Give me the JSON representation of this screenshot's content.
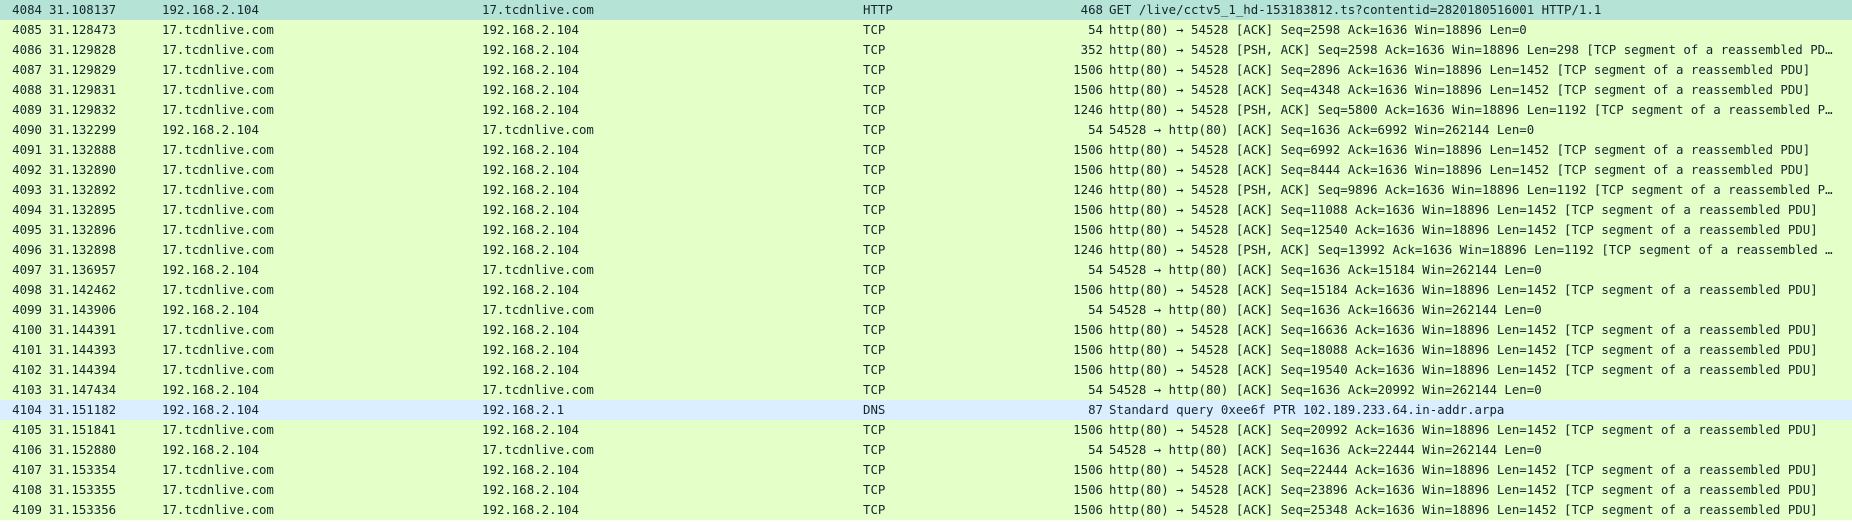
{
  "packets": [
    {
      "no": "4084",
      "time": "31.108137",
      "src": "192.168.2.104",
      "dst": "17.tcdnlive.com",
      "proto": "HTTP",
      "len": "468",
      "info": "GET /live/cctv5_1_hd-153183812.ts?contentid=2820180516001 HTTP/1.1",
      "kind": "http",
      "selected": true
    },
    {
      "no": "4085",
      "time": "31.128473",
      "src": "17.tcdnlive.com",
      "dst": "192.168.2.104",
      "proto": "TCP",
      "len": "54",
      "info": "http(80) → 54528 [ACK] Seq=2598 Ack=1636 Win=18896 Len=0",
      "kind": "tcp"
    },
    {
      "no": "4086",
      "time": "31.129828",
      "src": "17.tcdnlive.com",
      "dst": "192.168.2.104",
      "proto": "TCP",
      "len": "352",
      "info": "http(80) → 54528 [PSH, ACK] Seq=2598 Ack=1636 Win=18896 Len=298 [TCP segment of a reassembled PDU]",
      "kind": "tcp"
    },
    {
      "no": "4087",
      "time": "31.129829",
      "src": "17.tcdnlive.com",
      "dst": "192.168.2.104",
      "proto": "TCP",
      "len": "1506",
      "info": "http(80) → 54528 [ACK] Seq=2896 Ack=1636 Win=18896 Len=1452 [TCP segment of a reassembled PDU]",
      "kind": "tcp"
    },
    {
      "no": "4088",
      "time": "31.129831",
      "src": "17.tcdnlive.com",
      "dst": "192.168.2.104",
      "proto": "TCP",
      "len": "1506",
      "info": "http(80) → 54528 [ACK] Seq=4348 Ack=1636 Win=18896 Len=1452 [TCP segment of a reassembled PDU]",
      "kind": "tcp"
    },
    {
      "no": "4089",
      "time": "31.129832",
      "src": "17.tcdnlive.com",
      "dst": "192.168.2.104",
      "proto": "TCP",
      "len": "1246",
      "info": "http(80) → 54528 [PSH, ACK] Seq=5800 Ack=1636 Win=18896 Len=1192 [TCP segment of a reassembled PD…",
      "kind": "tcp"
    },
    {
      "no": "4090",
      "time": "31.132299",
      "src": "192.168.2.104",
      "dst": "17.tcdnlive.com",
      "proto": "TCP",
      "len": "54",
      "info": "54528 → http(80) [ACK] Seq=1636 Ack=6992 Win=262144 Len=0",
      "kind": "tcp"
    },
    {
      "no": "4091",
      "time": "31.132888",
      "src": "17.tcdnlive.com",
      "dst": "192.168.2.104",
      "proto": "TCP",
      "len": "1506",
      "info": "http(80) → 54528 [ACK] Seq=6992 Ack=1636 Win=18896 Len=1452 [TCP segment of a reassembled PDU]",
      "kind": "tcp"
    },
    {
      "no": "4092",
      "time": "31.132890",
      "src": "17.tcdnlive.com",
      "dst": "192.168.2.104",
      "proto": "TCP",
      "len": "1506",
      "info": "http(80) → 54528 [ACK] Seq=8444 Ack=1636 Win=18896 Len=1452 [TCP segment of a reassembled PDU]",
      "kind": "tcp"
    },
    {
      "no": "4093",
      "time": "31.132892",
      "src": "17.tcdnlive.com",
      "dst": "192.168.2.104",
      "proto": "TCP",
      "len": "1246",
      "info": "http(80) → 54528 [PSH, ACK] Seq=9896 Ack=1636 Win=18896 Len=1192 [TCP segment of a reassembled PD…",
      "kind": "tcp"
    },
    {
      "no": "4094",
      "time": "31.132895",
      "src": "17.tcdnlive.com",
      "dst": "192.168.2.104",
      "proto": "TCP",
      "len": "1506",
      "info": "http(80) → 54528 [ACK] Seq=11088 Ack=1636 Win=18896 Len=1452 [TCP segment of a reassembled PDU]",
      "kind": "tcp"
    },
    {
      "no": "4095",
      "time": "31.132896",
      "src": "17.tcdnlive.com",
      "dst": "192.168.2.104",
      "proto": "TCP",
      "len": "1506",
      "info": "http(80) → 54528 [ACK] Seq=12540 Ack=1636 Win=18896 Len=1452 [TCP segment of a reassembled PDU]",
      "kind": "tcp"
    },
    {
      "no": "4096",
      "time": "31.132898",
      "src": "17.tcdnlive.com",
      "dst": "192.168.2.104",
      "proto": "TCP",
      "len": "1246",
      "info": "http(80) → 54528 [PSH, ACK] Seq=13992 Ack=1636 Win=18896 Len=1192 [TCP segment of a reassembled P…",
      "kind": "tcp"
    },
    {
      "no": "4097",
      "time": "31.136957",
      "src": "192.168.2.104",
      "dst": "17.tcdnlive.com",
      "proto": "TCP",
      "len": "54",
      "info": "54528 → http(80) [ACK] Seq=1636 Ack=15184 Win=262144 Len=0",
      "kind": "tcp"
    },
    {
      "no": "4098",
      "time": "31.142462",
      "src": "17.tcdnlive.com",
      "dst": "192.168.2.104",
      "proto": "TCP",
      "len": "1506",
      "info": "http(80) → 54528 [ACK] Seq=15184 Ack=1636 Win=18896 Len=1452 [TCP segment of a reassembled PDU]",
      "kind": "tcp"
    },
    {
      "no": "4099",
      "time": "31.143906",
      "src": "192.168.2.104",
      "dst": "17.tcdnlive.com",
      "proto": "TCP",
      "len": "54",
      "info": "54528 → http(80) [ACK] Seq=1636 Ack=16636 Win=262144 Len=0",
      "kind": "tcp"
    },
    {
      "no": "4100",
      "time": "31.144391",
      "src": "17.tcdnlive.com",
      "dst": "192.168.2.104",
      "proto": "TCP",
      "len": "1506",
      "info": "http(80) → 54528 [ACK] Seq=16636 Ack=1636 Win=18896 Len=1452 [TCP segment of a reassembled PDU]",
      "kind": "tcp"
    },
    {
      "no": "4101",
      "time": "31.144393",
      "src": "17.tcdnlive.com",
      "dst": "192.168.2.104",
      "proto": "TCP",
      "len": "1506",
      "info": "http(80) → 54528 [ACK] Seq=18088 Ack=1636 Win=18896 Len=1452 [TCP segment of a reassembled PDU]",
      "kind": "tcp"
    },
    {
      "no": "4102",
      "time": "31.144394",
      "src": "17.tcdnlive.com",
      "dst": "192.168.2.104",
      "proto": "TCP",
      "len": "1506",
      "info": "http(80) → 54528 [ACK] Seq=19540 Ack=1636 Win=18896 Len=1452 [TCP segment of a reassembled PDU]",
      "kind": "tcp"
    },
    {
      "no": "4103",
      "time": "31.147434",
      "src": "192.168.2.104",
      "dst": "17.tcdnlive.com",
      "proto": "TCP",
      "len": "54",
      "info": "54528 → http(80) [ACK] Seq=1636 Ack=20992 Win=262144 Len=0",
      "kind": "tcp"
    },
    {
      "no": "4104",
      "time": "31.151182",
      "src": "192.168.2.104",
      "dst": "192.168.2.1",
      "proto": "DNS",
      "len": "87",
      "info": "Standard query 0xee6f PTR 102.189.233.64.in-addr.arpa",
      "kind": "dns"
    },
    {
      "no": "4105",
      "time": "31.151841",
      "src": "17.tcdnlive.com",
      "dst": "192.168.2.104",
      "proto": "TCP",
      "len": "1506",
      "info": "http(80) → 54528 [ACK] Seq=20992 Ack=1636 Win=18896 Len=1452 [TCP segment of a reassembled PDU]",
      "kind": "tcp"
    },
    {
      "no": "4106",
      "time": "31.152880",
      "src": "192.168.2.104",
      "dst": "17.tcdnlive.com",
      "proto": "TCP",
      "len": "54",
      "info": "54528 → http(80) [ACK] Seq=1636 Ack=22444 Win=262144 Len=0",
      "kind": "tcp"
    },
    {
      "no": "4107",
      "time": "31.153354",
      "src": "17.tcdnlive.com",
      "dst": "192.168.2.104",
      "proto": "TCP",
      "len": "1506",
      "info": "http(80) → 54528 [ACK] Seq=22444 Ack=1636 Win=18896 Len=1452 [TCP segment of a reassembled PDU]",
      "kind": "tcp"
    },
    {
      "no": "4108",
      "time": "31.153355",
      "src": "17.tcdnlive.com",
      "dst": "192.168.2.104",
      "proto": "TCP",
      "len": "1506",
      "info": "http(80) → 54528 [ACK] Seq=23896 Ack=1636 Win=18896 Len=1452 [TCP segment of a reassembled PDU]",
      "kind": "tcp"
    },
    {
      "no": "4109",
      "time": "31.153356",
      "src": "17.tcdnlive.com",
      "dst": "192.168.2.104",
      "proto": "TCP",
      "len": "1506",
      "info": "http(80) → 54528 [ACK] Seq=25348 Ack=1636 Win=18896 Len=1452 [TCP segment of a reassembled PDU]",
      "kind": "tcp"
    }
  ],
  "colors": {
    "tcp_http_row": "#e4ffc7",
    "dns_row": "#daeeff",
    "selected_row": "#b5e3d6",
    "text": "#12272e"
  }
}
